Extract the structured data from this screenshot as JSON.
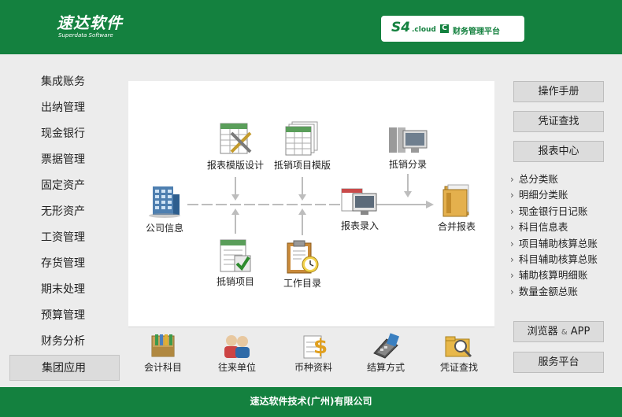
{
  "header": {
    "logo_cn": "速达软件",
    "logo_en": "Superdata Software",
    "platform_s4": "S4",
    "platform_cloud": ".cloud",
    "platform_c": "C",
    "platform_text": "财务管理平台"
  },
  "left_menu": {
    "items": [
      {
        "label": "集成账务"
      },
      {
        "label": "出纳管理"
      },
      {
        "label": "现金银行"
      },
      {
        "label": "票据管理"
      },
      {
        "label": "固定资产"
      },
      {
        "label": "无形资产"
      },
      {
        "label": "工资管理"
      },
      {
        "label": "存货管理"
      },
      {
        "label": "期末处理"
      },
      {
        "label": "预算管理"
      },
      {
        "label": "财务分析"
      },
      {
        "label": "集团应用"
      }
    ],
    "active_index": 11
  },
  "flow": {
    "company_info": "公司信息",
    "report_template_design": "报表模版设计",
    "elim_item_template": "抵销项目模版",
    "elim_entries": "抵销分录",
    "report_entry": "报表录入",
    "consolidated_report": "合并报表",
    "elim_items": "抵销项目",
    "work_directory": "工作目录"
  },
  "bottom": {
    "items": [
      {
        "label": "会计科目"
      },
      {
        "label": "往来单位"
      },
      {
        "label": "币种资料"
      },
      {
        "label": "结算方式"
      },
      {
        "label": "凭证查找"
      }
    ]
  },
  "right": {
    "manual": "操作手册",
    "voucher_search": "凭证查找",
    "report_center": "报表中心",
    "reports": [
      "总分类账",
      "明细分类账",
      "现金银行日记账",
      "科目信息表",
      "项目辅助核算总账",
      "科目辅助核算总账",
      "辅助核算明细账",
      "数量金额总账"
    ],
    "browser_text": "浏览器",
    "browser_amp": "&",
    "browser_app": "APP",
    "service_platform": "服务平台"
  },
  "footer": {
    "text": "速达软件技术(广州)有限公司"
  },
  "colors": {
    "brand_green": "#14813f",
    "panel_bg": "#ececec",
    "button_bg": "#dcdcdc"
  }
}
